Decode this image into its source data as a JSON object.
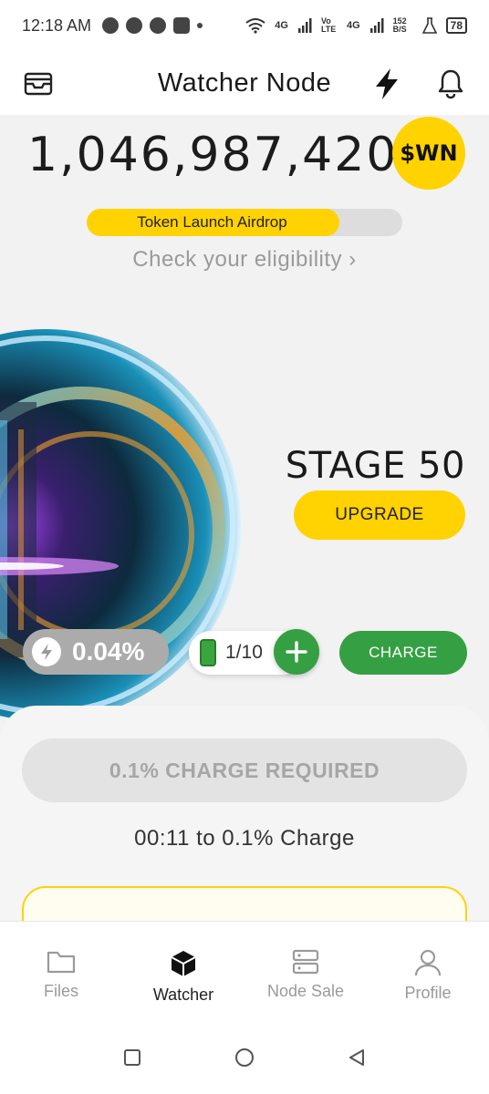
{
  "status_bar": {
    "time": "12:18 AM",
    "network_1": "4G",
    "network_volte": "Vo LTE",
    "network_2": "4G",
    "speed": "152 B/S",
    "battery": "78"
  },
  "header": {
    "title": "Watcher Node",
    "left_icon": "wallet-icon",
    "right_icons": [
      "lightning-icon",
      "bell-icon"
    ]
  },
  "balance": {
    "amount": "1,046,987,420",
    "token": "$WN"
  },
  "airdrop": {
    "label": "Token Launch Airdrop",
    "progress": 0.8,
    "eligibility": "Check your eligibility ›"
  },
  "node": {
    "stage": "STAGE 50",
    "upgrade_label": "UPGRADE",
    "percent": "0.04%",
    "charges": "1/10",
    "charge_label": "CHARGE"
  },
  "sheet": {
    "required": "0.1% CHARGE REQUIRED",
    "timer": "00:11 to 0.1% Charge"
  },
  "nav": {
    "items": [
      {
        "label": "Files",
        "icon": "folder-icon"
      },
      {
        "label": "Watcher",
        "icon": "cube-icon"
      },
      {
        "label": "Node Sale",
        "icon": "server-icon"
      },
      {
        "label": "Profile",
        "icon": "user-icon"
      }
    ],
    "active": "Watcher"
  },
  "colors": {
    "accent_yellow": "#ffd200",
    "accent_green": "#35a043"
  }
}
